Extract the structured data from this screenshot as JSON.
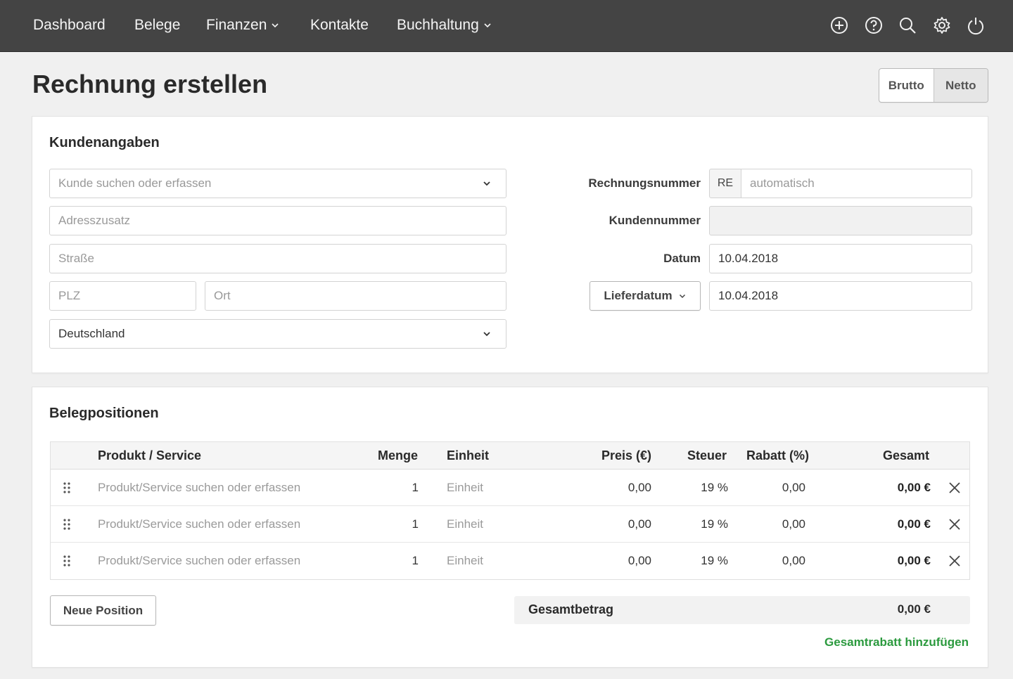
{
  "nav": {
    "items": [
      {
        "label": "Dashboard",
        "dropdown": false
      },
      {
        "label": "Belege",
        "dropdown": false
      },
      {
        "label": "Finanzen",
        "dropdown": true
      },
      {
        "label": "Kontakte",
        "dropdown": false
      },
      {
        "label": "Buchhaltung",
        "dropdown": true
      }
    ],
    "icons": [
      "plus-circle-icon",
      "help-icon",
      "search-icon",
      "settings-icon",
      "power-icon"
    ]
  },
  "header": {
    "title": "Rechnung erstellen",
    "toggle": {
      "options": [
        "Brutto",
        "Netto"
      ],
      "active": "Netto"
    }
  },
  "customer": {
    "title": "Kundenangaben",
    "customer_select": {
      "placeholder": "Kunde suchen oder erfassen"
    },
    "address_extra": {
      "placeholder": "Adresszusatz"
    },
    "street": {
      "placeholder": "Straße"
    },
    "zip": {
      "placeholder": "PLZ"
    },
    "city": {
      "placeholder": "Ort"
    },
    "country": {
      "value": "Deutschland"
    },
    "invoice_number": {
      "label": "Rechnungsnummer",
      "prefix": "RE",
      "placeholder": "automatisch"
    },
    "customer_number": {
      "label": "Kundennummer",
      "value": ""
    },
    "date": {
      "label": "Datum",
      "value": "10.04.2018"
    },
    "delivery": {
      "label": "Lieferdatum",
      "value": "10.04.2018"
    }
  },
  "positions": {
    "title": "Belegpositionen",
    "columns": [
      "Produkt / Service",
      "Menge",
      "Einheit",
      "Preis (€)",
      "Steuer",
      "Rabatt (%)",
      "Gesamt"
    ],
    "rows": [
      {
        "product": "Produkt/Service suchen oder erfassen",
        "qty": "1",
        "unit": "Einheit",
        "price": "0,00",
        "tax": "19 %",
        "discount": "0,00",
        "total": "0,00 €"
      },
      {
        "product": "Produkt/Service suchen oder erfassen",
        "qty": "1",
        "unit": "Einheit",
        "price": "0,00",
        "tax": "19 %",
        "discount": "0,00",
        "total": "0,00 €"
      },
      {
        "product": "Produkt/Service suchen oder erfassen",
        "qty": "1",
        "unit": "Einheit",
        "price": "0,00",
        "tax": "19 %",
        "discount": "0,00",
        "total": "0,00 €"
      }
    ],
    "new_position": "Neue Position",
    "total_label": "Gesamtbetrag",
    "total_value": "0,00 €",
    "add_discount": "Gesamtrabatt hinzufügen"
  },
  "colors": {
    "nav_bg": "#444444",
    "link_green": "#2b9a3e",
    "page_bg": "#f0f0f0"
  }
}
